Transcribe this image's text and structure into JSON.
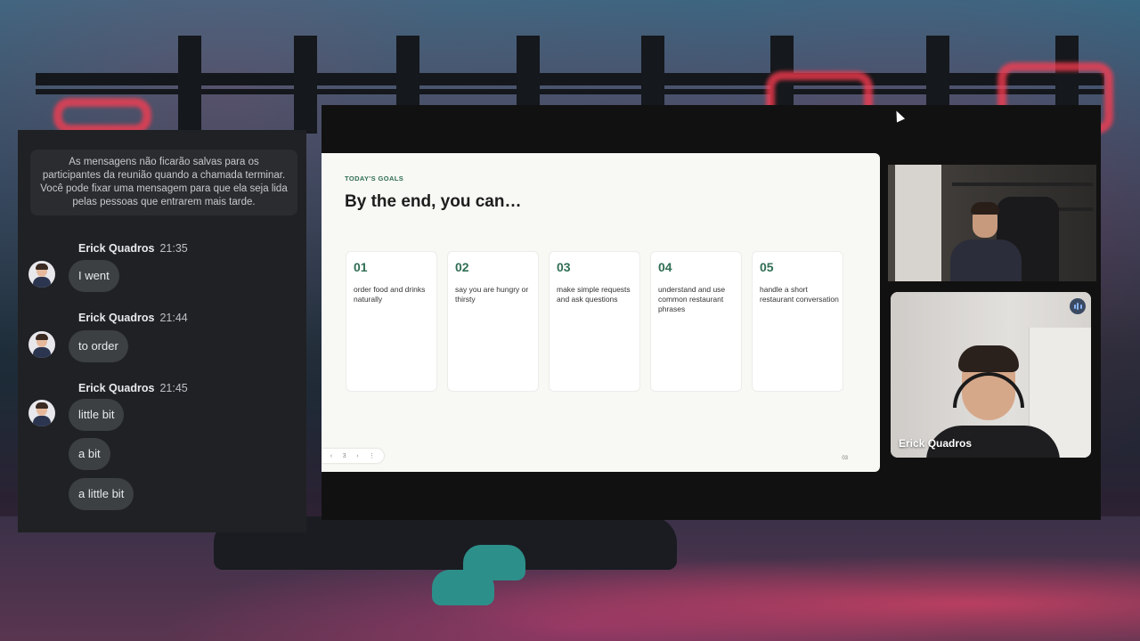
{
  "chat": {
    "notice": "As mensagens não ficarão salvas para os participantes da reunião quando a chamada terminar. Você pode fixar uma mensagem para que ela seja lida pelas pessoas que entrarem mais tarde.",
    "groups": [
      {
        "sender": "Erick Quadros",
        "time": "21:35",
        "messages": [
          "I went"
        ]
      },
      {
        "sender": "Erick Quadros",
        "time": "21:44",
        "messages": [
          "to order"
        ]
      },
      {
        "sender": "Erick Quadros",
        "time": "21:45",
        "messages": [
          "little bit",
          "a bit",
          "a little bit"
        ]
      }
    ]
  },
  "slide": {
    "eyebrow": "TODAY'S GOALS",
    "title": "By the end, you can…",
    "goals": [
      {
        "number": "01",
        "text": "order food and drinks naturally"
      },
      {
        "number": "02",
        "text": "say you are hungry or thirsty"
      },
      {
        "number": "03",
        "text": "make simple requests and ask questions"
      },
      {
        "number": "04",
        "text": "understand and use common restaurant phrases"
      },
      {
        "number": "05",
        "text": "handle a short restaurant conversation"
      }
    ],
    "nav": {
      "prev": "‹",
      "page": "3",
      "next": "›",
      "more": "⋮"
    },
    "page_number": "03"
  },
  "video": {
    "speaker_name": "Erick Quadros",
    "speaking_icon": "audio-level-icon",
    "accent_color": "#8ab4f8"
  }
}
